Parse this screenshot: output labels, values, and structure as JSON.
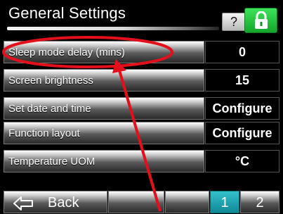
{
  "header": {
    "title": "General Settings",
    "help_label": "?"
  },
  "settings": [
    {
      "label": "Sleep mode delay (mins)",
      "value": "0"
    },
    {
      "label": "Screen brightness",
      "value": "15"
    },
    {
      "label": "Set date and time",
      "value": "Configure"
    },
    {
      "label": "Function layout",
      "value": "Configure"
    },
    {
      "label": "Temperature UOM",
      "value": "°C"
    }
  ],
  "footer": {
    "back_label": "Back",
    "pages": [
      "1",
      "2"
    ],
    "active_page": "1"
  },
  "icons": {
    "lock": "lock-icon",
    "back": "back-arrow-icon",
    "help": "help-icon"
  },
  "colors": {
    "lock_green": "#22c23c",
    "active_page": "#1ea6b2",
    "annotation_red": "#e3101c"
  }
}
